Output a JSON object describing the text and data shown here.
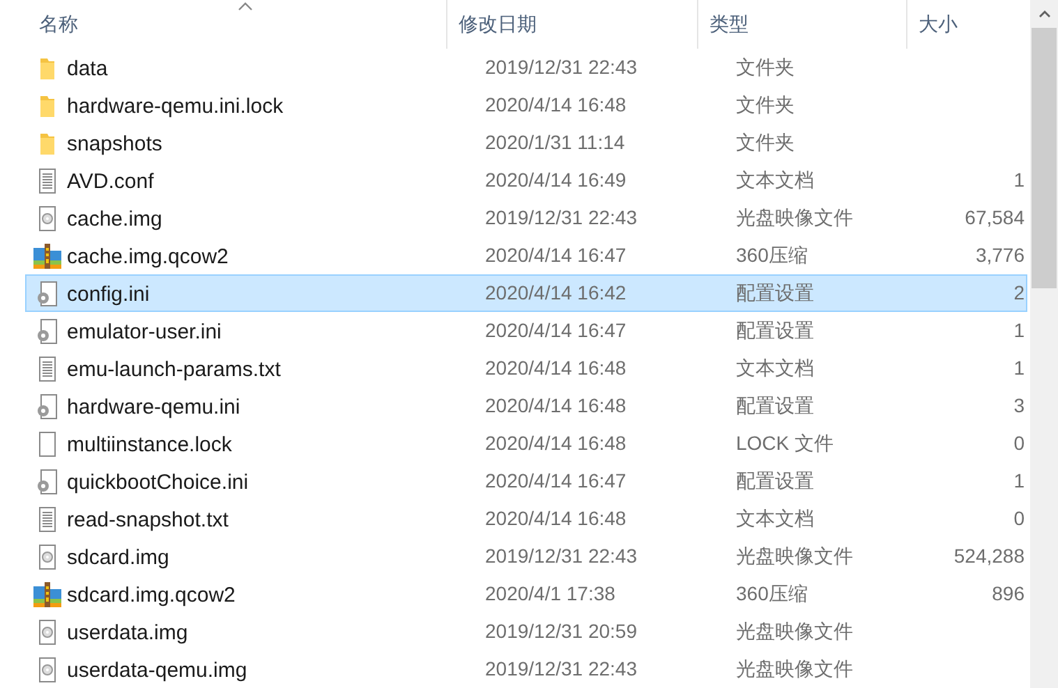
{
  "columns": [
    {
      "label": "名称",
      "sorted": true
    },
    {
      "label": "修改日期",
      "sorted": false
    },
    {
      "label": "类型",
      "sorted": false
    },
    {
      "label": "大小",
      "sorted": false
    }
  ],
  "rows": [
    {
      "kind": "folder",
      "name": "data",
      "date": "2019/12/31 22:43",
      "type": "文件夹",
      "selected": false
    },
    {
      "kind": "folder",
      "name": "hardware-qemu.ini.lock",
      "date": "2020/4/14 16:48",
      "type": "文件夹",
      "selected": false
    },
    {
      "kind": "folder",
      "name": "snapshots",
      "date": "2020/1/31 11:14",
      "type": "文件夹",
      "selected": false
    },
    {
      "kind": "text",
      "name": "AVD.conf",
      "date": "2020/4/14 16:49",
      "type": "文本文档",
      "size": "1",
      "selected": false
    },
    {
      "kind": "disc",
      "name": "cache.img",
      "date": "2019/12/31 22:43",
      "type": "光盘映像文件",
      "size": "67,584",
      "selected": false
    },
    {
      "kind": "archive",
      "name": "cache.img.qcow2",
      "date": "2020/4/14 16:47",
      "type": "360压缩",
      "size": "3,776",
      "selected": false
    },
    {
      "kind": "config",
      "name": "config.ini",
      "date": "2020/4/14 16:42",
      "type": "配置设置",
      "size": "2",
      "selected": true
    },
    {
      "kind": "config",
      "name": "emulator-user.ini",
      "date": "2020/4/14 16:47",
      "type": "配置设置",
      "size": "1",
      "selected": false
    },
    {
      "kind": "text",
      "name": "emu-launch-params.txt",
      "date": "2020/4/14 16:48",
      "type": "文本文档",
      "size": "1",
      "selected": false
    },
    {
      "kind": "config",
      "name": "hardware-qemu.ini",
      "date": "2020/4/14 16:48",
      "type": "配置设置",
      "size": "3",
      "selected": false
    },
    {
      "kind": "file",
      "name": "multiinstance.lock",
      "date": "2020/4/14 16:48",
      "type": "LOCK 文件",
      "size": "0",
      "selected": false
    },
    {
      "kind": "config",
      "name": "quickbootChoice.ini",
      "date": "2020/4/14 16:47",
      "type": "配置设置",
      "size": "1",
      "selected": false
    },
    {
      "kind": "text",
      "name": "read-snapshot.txt",
      "date": "2020/4/14 16:48",
      "type": "文本文档",
      "size": "0",
      "selected": false
    },
    {
      "kind": "disc",
      "name": "sdcard.img",
      "date": "2019/12/31 22:43",
      "type": "光盘映像文件",
      "size": "524,288",
      "selected": false
    },
    {
      "kind": "archive",
      "name": "sdcard.img.qcow2",
      "date": "2020/4/1 17:38",
      "type": "360压缩",
      "size": "896",
      "selected": false
    },
    {
      "kind": "disc",
      "name": "userdata.img",
      "date": "2019/12/31 20:59",
      "type": "光盘映像文件",
      "selected": false
    },
    {
      "kind": "disc",
      "name": "userdata-qemu.img",
      "date": "2019/12/31 22:43",
      "type": "光盘映像文件",
      "selected": false
    }
  ]
}
